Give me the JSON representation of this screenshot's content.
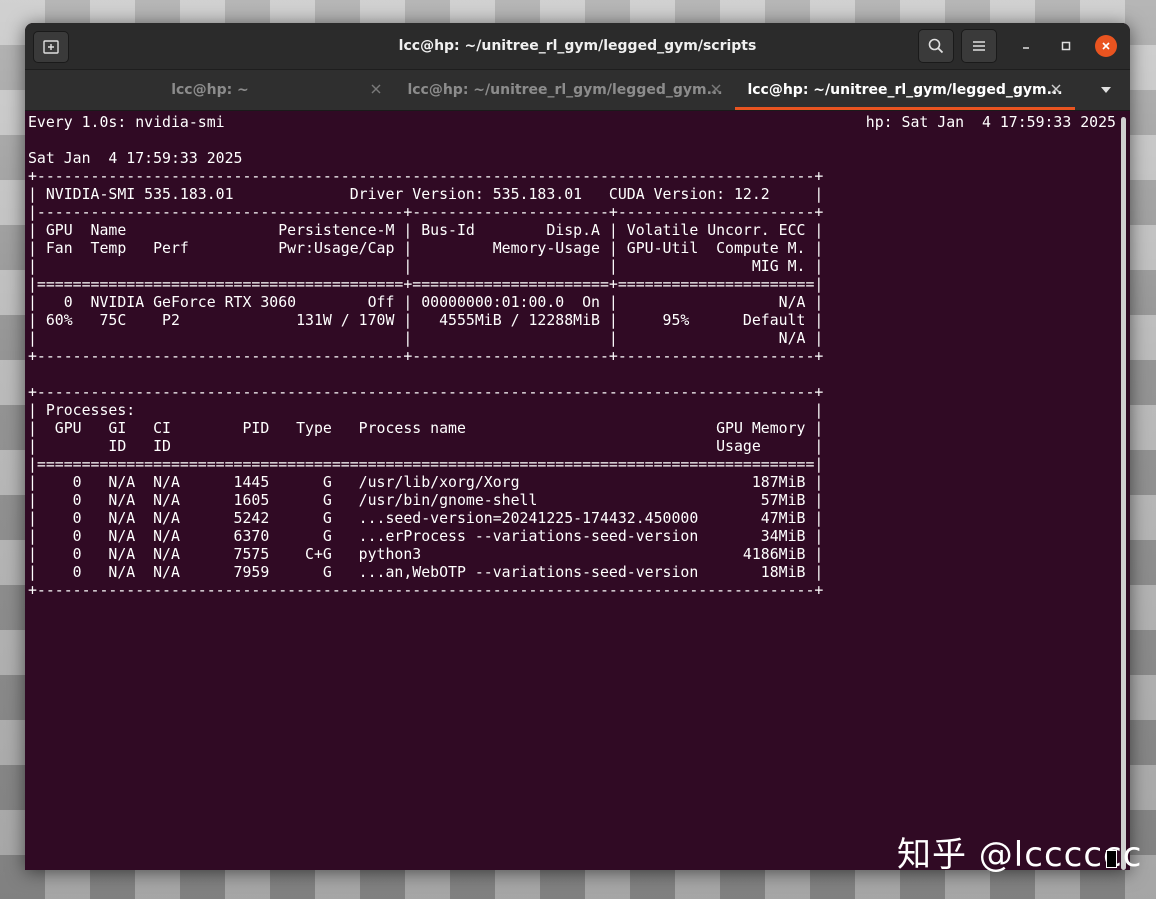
{
  "window": {
    "title": "lcc@hp: ~/unitree_rl_gym/legged_gym/scripts"
  },
  "tabs": [
    {
      "label": "lcc@hp: ~",
      "active": false
    },
    {
      "label": "lcc@hp: ~/unitree_rl_gym/legged_gym...",
      "active": false
    },
    {
      "label": "lcc@hp: ~/unitree_rl_gym/legged_gym...",
      "active": true
    }
  ],
  "icons": {
    "new_tab": "new-tab-icon",
    "search": "search-icon",
    "menu": "hamburger-menu-icon",
    "minimize": "minimize-icon",
    "maximize": "maximize-icon",
    "close": "close-icon",
    "tab_close": "close-icon",
    "dropdown": "chevron-down-icon"
  },
  "colors": {
    "terminal_background": "#300a24",
    "accent": "#e95420",
    "text": "#ffffff"
  },
  "terminal": {
    "header_left": "Every 1.0s: nvidia-smi",
    "header_right": "hp: Sat Jan  4 17:59:33 2025",
    "output": "\nSat Jan  4 17:59:33 2025\n+---------------------------------------------------------------------------------------+\n| NVIDIA-SMI 535.183.01             Driver Version: 535.183.01   CUDA Version: 12.2     |\n|-----------------------------------------+----------------------+----------------------+\n| GPU  Name                 Persistence-M | Bus-Id        Disp.A | Volatile Uncorr. ECC |\n| Fan  Temp   Perf          Pwr:Usage/Cap |         Memory-Usage | GPU-Util  Compute M. |\n|                                         |                      |               MIG M. |\n|=========================================+======================+======================|\n|   0  NVIDIA GeForce RTX 3060        Off | 00000000:01:00.0  On |                  N/A |\n| 60%   75C    P2             131W / 170W |   4555MiB / 12288MiB |     95%      Default |\n|                                         |                      |                  N/A |\n+-----------------------------------------+----------------------+----------------------+\n\n+---------------------------------------------------------------------------------------+\n| Processes:                                                                            |\n|  GPU   GI   CI        PID   Type   Process name                            GPU Memory |\n|        ID   ID                                                             Usage      |\n|=======================================================================================|\n|    0   N/A  N/A      1445      G   /usr/lib/xorg/Xorg                          187MiB |\n|    0   N/A  N/A      1605      G   /usr/bin/gnome-shell                         57MiB |\n|    0   N/A  N/A      5242      G   ...seed-version=20241225-174432.450000       47MiB |\n|    0   N/A  N/A      6370      G   ...erProcess --variations-seed-version       34MiB |\n|    0   N/A  N/A      7575    C+G   python3                                    4186MiB |\n|    0   N/A  N/A      7959      G   ...an,WebOTP --variations-seed-version       18MiB |\n+---------------------------------------------------------------------------------------+"
  },
  "watermark": "知乎 @lcccccc"
}
